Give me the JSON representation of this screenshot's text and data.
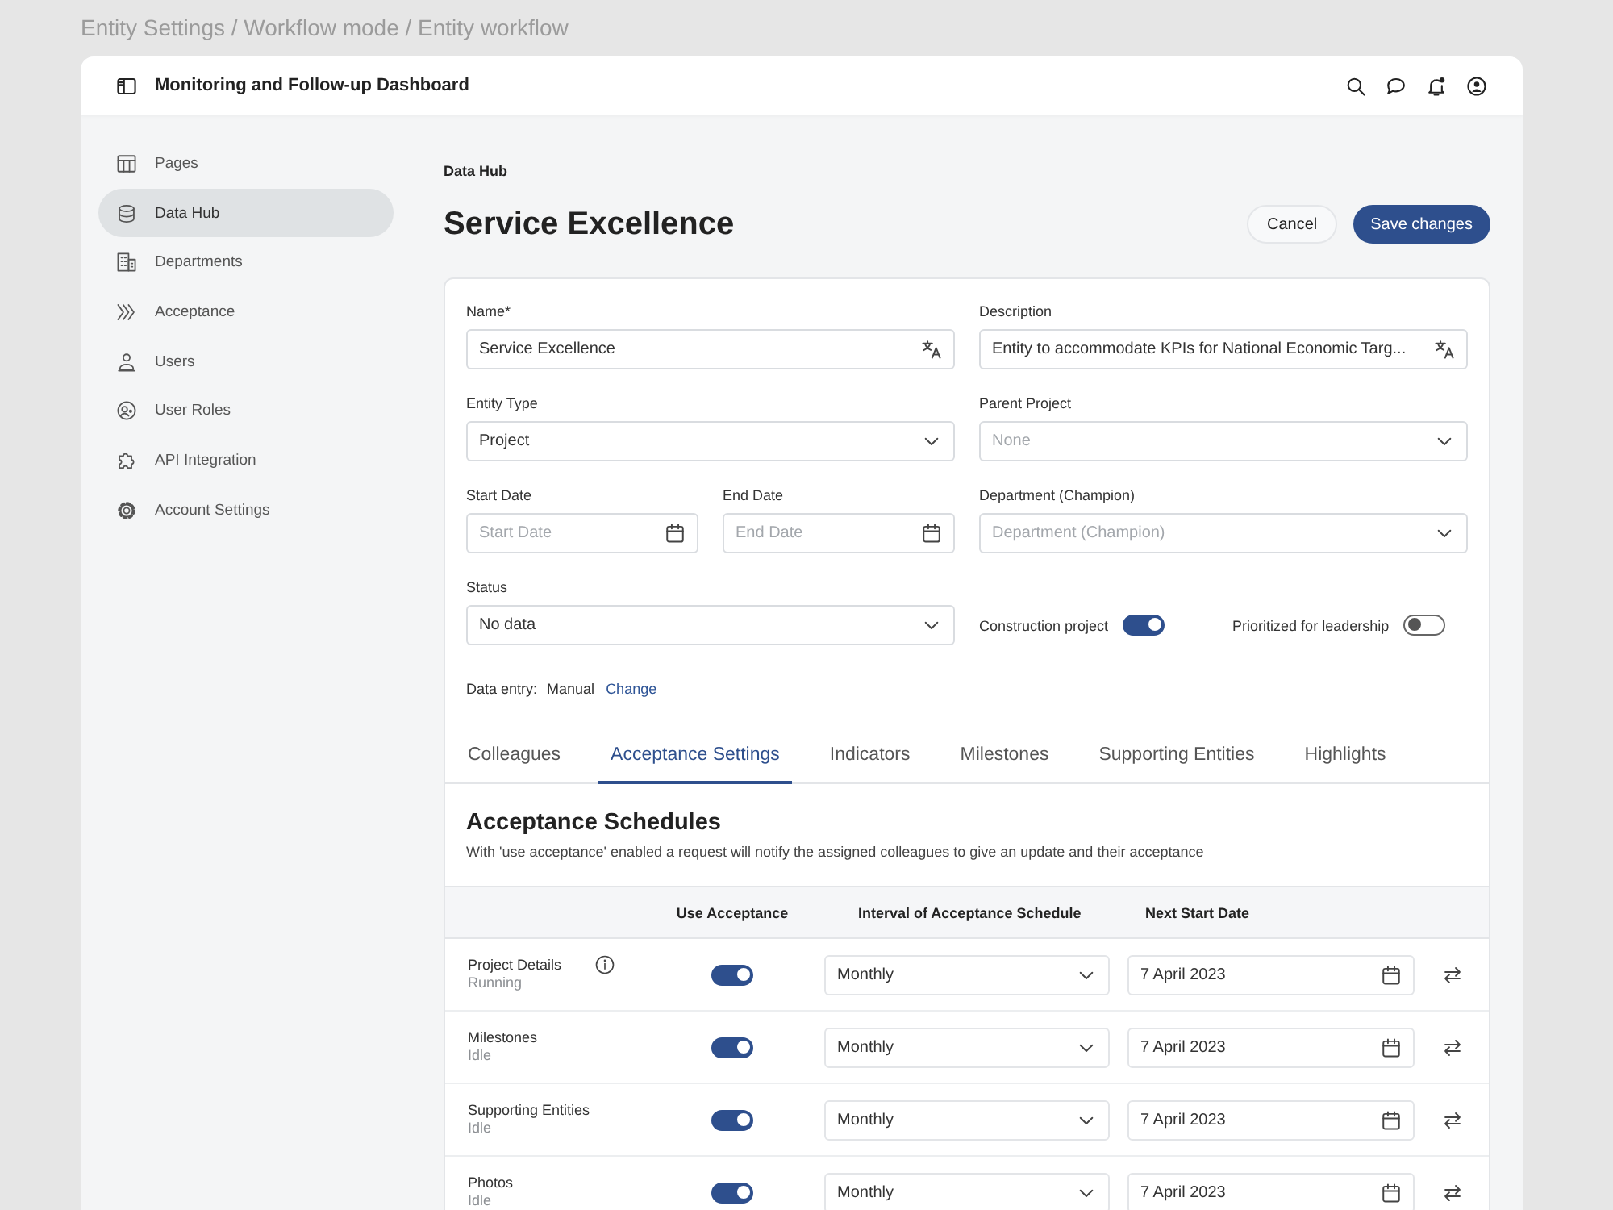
{
  "breadcrumb": "Entity Settings / Workflow mode / Entity workflow",
  "header": {
    "title": "Monitoring and Follow-up Dashboard"
  },
  "sidebar": {
    "items": [
      {
        "label": "Pages",
        "selected": false
      },
      {
        "label": "Data Hub",
        "selected": true
      },
      {
        "label": "Departments",
        "selected": false
      },
      {
        "label": "Acceptance",
        "selected": false
      },
      {
        "label": "Users",
        "selected": false
      },
      {
        "label": "User Roles",
        "selected": false
      },
      {
        "label": "API Integration",
        "selected": false
      },
      {
        "label": "Account Settings",
        "selected": false
      }
    ]
  },
  "page": {
    "section": "Data Hub",
    "title": "Service Excellence",
    "buttons": [
      {
        "label": "Cancel",
        "kind": "secondary"
      },
      {
        "label": "Save changes",
        "kind": "primary"
      }
    ]
  },
  "form": {
    "fields": [
      {
        "kind": "text",
        "label": "Name*",
        "value": "Service Excellence"
      },
      {
        "kind": "text",
        "label": "Description",
        "value": "Entity to accommodate KPIs for National Economic Targ..."
      },
      {
        "kind": "select",
        "label": "Entity Type",
        "value": "Project"
      },
      {
        "kind": "select",
        "label": "Parent Project",
        "placeholder": "None"
      },
      {
        "kind": "date",
        "label": "Start Date",
        "placeholder": "Start Date"
      },
      {
        "kind": "date",
        "label": "End Date",
        "placeholder": "End Date"
      },
      {
        "kind": "select",
        "label": "Department (Champion)",
        "placeholder": "Department (Champion)"
      },
      {
        "kind": "select",
        "label": "Status",
        "value": "No data"
      }
    ],
    "switches": [
      {
        "label": "Construction project",
        "on": true
      },
      {
        "label": "Prioritized for leadership",
        "on": false
      }
    ],
    "data_entry": {
      "label": "Data entry:",
      "value": "Manual",
      "link": "Change"
    }
  },
  "tabs": [
    {
      "label": "Colleagues",
      "selected": false
    },
    {
      "label": "Acceptance Settings",
      "selected": true
    },
    {
      "label": "Indicators",
      "selected": false
    },
    {
      "label": "Milestones",
      "selected": false
    },
    {
      "label": "Supporting Entities",
      "selected": false
    },
    {
      "label": "Highlights",
      "selected": false
    }
  ],
  "acceptance": {
    "title": "Acceptance Schedules",
    "description": "With 'use acceptance' enabled a request will notify the assigned colleagues to give an update and their acceptance",
    "columns": [
      "Use Acceptance",
      "Interval of Acceptance Schedule",
      "Next Start Date"
    ],
    "rows": [
      {
        "name": "Project Details",
        "status": "Running",
        "info": true,
        "use_acceptance": true,
        "interval": "Monthly",
        "next_start_date": "7 April 2023"
      },
      {
        "name": "Milestones",
        "status": "Idle",
        "info": false,
        "use_acceptance": true,
        "interval": "Monthly",
        "next_start_date": "7 April 2023"
      },
      {
        "name": "Supporting Entities",
        "status": "Idle",
        "info": false,
        "use_acceptance": true,
        "interval": "Monthly",
        "next_start_date": "7 April 2023"
      },
      {
        "name": "Photos",
        "status": "Idle",
        "info": false,
        "use_acceptance": true,
        "interval": "Monthly",
        "next_start_date": "7 April 2023"
      }
    ]
  }
}
